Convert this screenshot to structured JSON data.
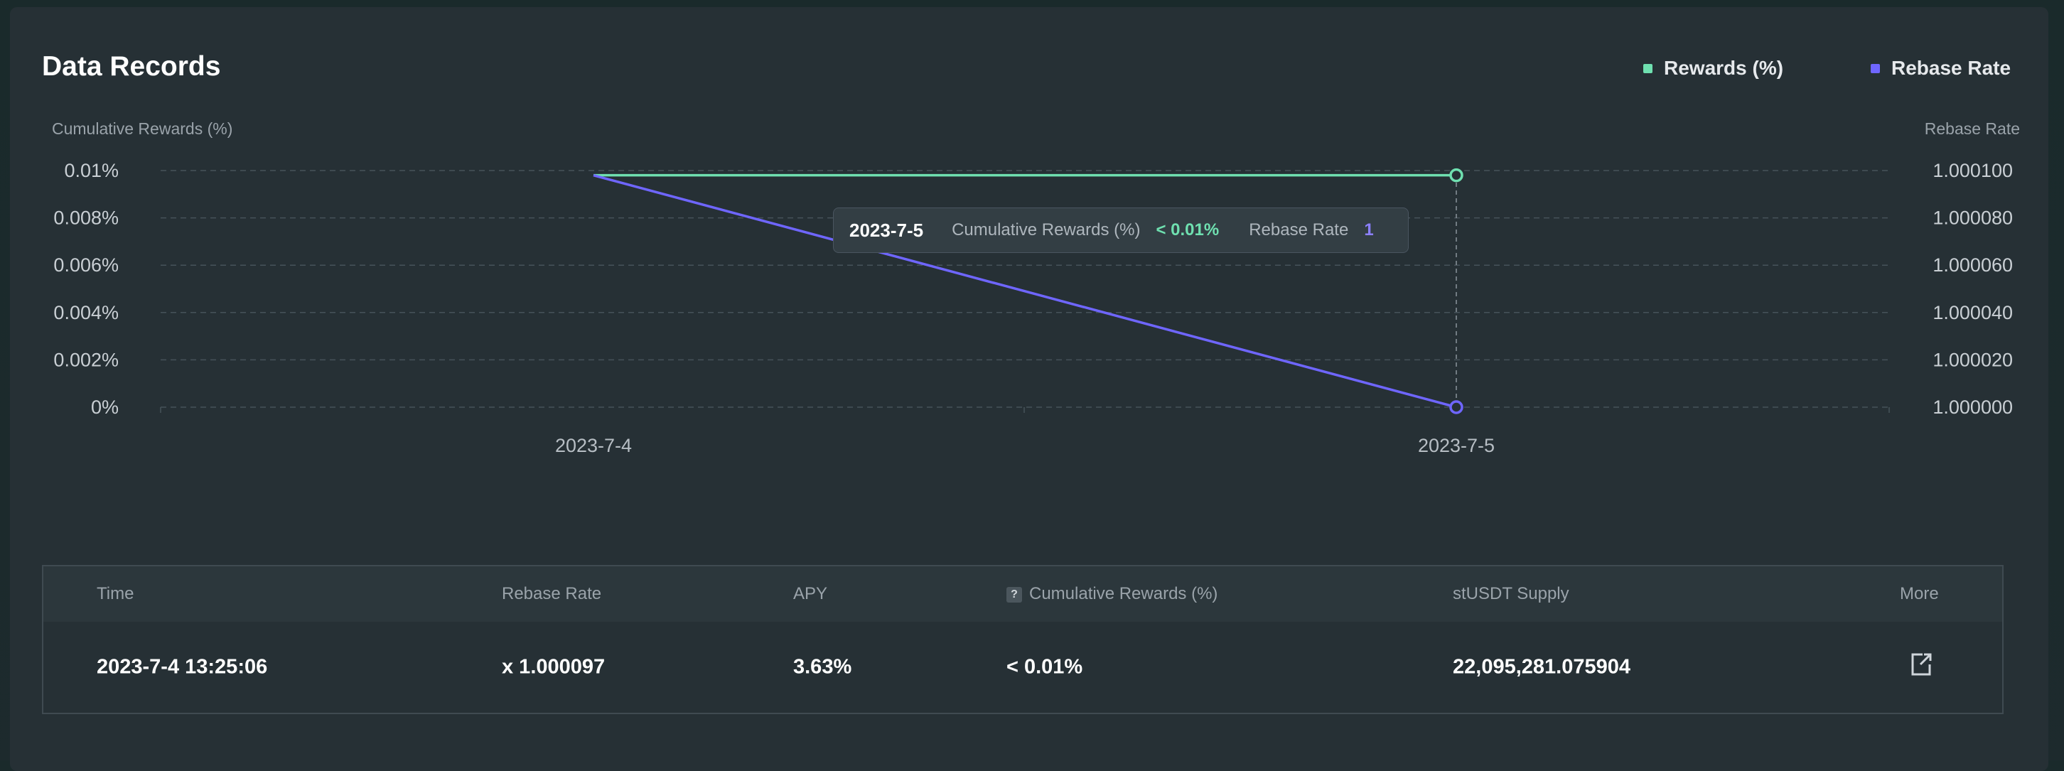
{
  "header": {
    "title": "Data Records"
  },
  "legend": [
    {
      "label": "Rewards (%)",
      "color": "#6fe0b0"
    },
    {
      "label": "Rebase Rate",
      "color": "#6f66ff"
    }
  ],
  "chart_data": {
    "type": "line",
    "x": [
      "2023-7-4",
      "2023-7-5"
    ],
    "left_axis": {
      "label": "Cumulative Rewards (%)",
      "ticks": [
        "0.01%",
        "0.008%",
        "0.006%",
        "0.004%",
        "0.002%",
        "0%"
      ],
      "range": [
        0,
        0.01
      ]
    },
    "right_axis": {
      "label": "Rebase Rate",
      "ticks": [
        "1.000100",
        "1.000080",
        "1.000060",
        "1.000040",
        "1.000020",
        "1.000000"
      ],
      "range": [
        1.0,
        1.0001
      ]
    },
    "series": [
      {
        "name": "Rewards (%)",
        "axis": "left",
        "color": "#6fe0b0",
        "values": [
          0.0098,
          0.0098
        ]
      },
      {
        "name": "Rebase Rate",
        "axis": "right",
        "color": "#6f66ff",
        "values": [
          1.000098,
          1.0
        ]
      }
    ],
    "grid": true,
    "legend_position": "top-right",
    "tooltip": {
      "date": "2023-7-5",
      "label1": "Cumulative Rewards (%)",
      "value1": "< 0.01%",
      "label2": "Rebase Rate",
      "value2": "1"
    }
  },
  "table": {
    "headers": {
      "time": "Time",
      "rebase_rate": "Rebase Rate",
      "apy": "APY",
      "cumulative": "Cumulative Rewards (%)",
      "supply": "stUSDT Supply",
      "more": "More"
    },
    "help_glyph": "?",
    "rows": [
      {
        "time": "2023-7-4 13:25:06",
        "rebase_rate": "x 1.000097",
        "apy": "3.63%",
        "cumulative": "< 0.01%",
        "supply": "22,095,281.075904"
      }
    ]
  }
}
